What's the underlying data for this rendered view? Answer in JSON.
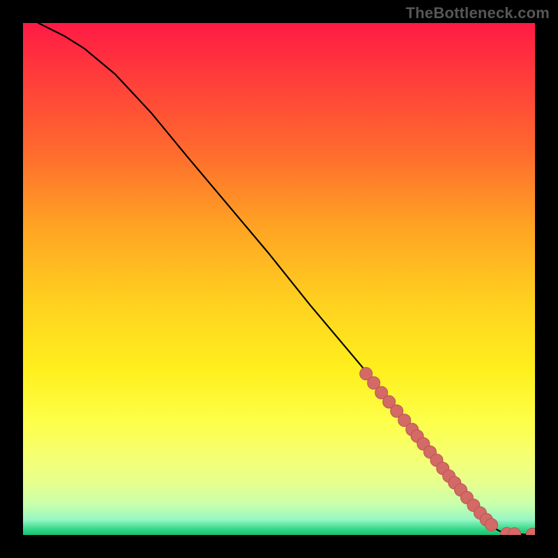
{
  "watermark": "TheBottleneck.com",
  "chart_data": {
    "type": "line",
    "title": "",
    "xlabel": "",
    "ylabel": "",
    "xlim": [
      0,
      100
    ],
    "ylim": [
      0,
      100
    ],
    "grid": false,
    "legend": false,
    "series": [
      {
        "name": "curve",
        "x": [
          3,
          5,
          8,
          12,
          18,
          25,
          32,
          40,
          48,
          56,
          64,
          72,
          78,
          84,
          88,
          91,
          93,
          95,
          97,
          99,
          100
        ],
        "y": [
          100,
          99,
          97.5,
          95,
          90,
          82.5,
          74,
          64.5,
          55,
          45,
          35.5,
          26,
          18,
          10.5,
          5,
          2,
          0.8,
          0.3,
          0.15,
          0.08,
          0.05
        ]
      }
    ],
    "points": {
      "name": "highlighted-points",
      "x": [
        67,
        68.5,
        70,
        71.5,
        73,
        74.5,
        76,
        77,
        78.2,
        79.5,
        80.8,
        82,
        83.2,
        84.3,
        85.5,
        86.7,
        88,
        89.3,
        90.5,
        91.5,
        94.5,
        96,
        99.5
      ],
      "y": [
        31.5,
        29.7,
        27.8,
        26,
        24.2,
        22.4,
        20.6,
        19.3,
        17.8,
        16.2,
        14.6,
        13,
        11.5,
        10.2,
        8.8,
        7.3,
        5.8,
        4.3,
        3,
        2,
        0.25,
        0.2,
        0.1
      ]
    },
    "background_gradient": {
      "top": "#ff1a45",
      "mid": "#fff01e",
      "bottom": "#18c172"
    }
  }
}
